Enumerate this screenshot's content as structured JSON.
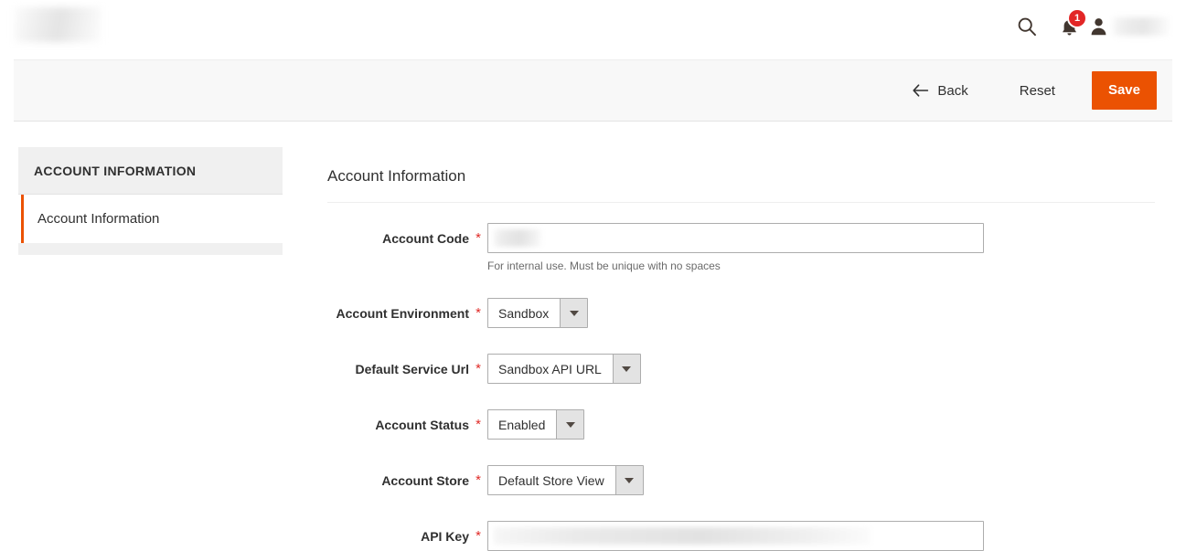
{
  "header": {
    "logo_redacted": true,
    "search_icon": "search-icon",
    "notifications_icon": "bell-icon",
    "notifications_count": "1",
    "user_icon": "user-icon",
    "user_name_redacted": true
  },
  "toolbar": {
    "back_label": "Back",
    "back_icon": "arrow-left-icon",
    "reset_label": "Reset",
    "save_label": "Save",
    "save_color": "#eb5202"
  },
  "sidebar": {
    "title": "ACCOUNT INFORMATION",
    "items": [
      {
        "label": "Account Information",
        "active": true
      }
    ]
  },
  "main": {
    "section_title": "Account Information",
    "fields": [
      {
        "label": "Account Code",
        "required": "*",
        "type": "text",
        "value": "",
        "redacted": true,
        "help": "For internal use. Must be unique with no spaces"
      },
      {
        "label": "Account Environment",
        "required": "*",
        "type": "select",
        "value": "Sandbox"
      },
      {
        "label": "Default Service Url",
        "required": "*",
        "type": "select",
        "value": "Sandbox API URL"
      },
      {
        "label": "Account Status",
        "required": "*",
        "type": "select",
        "value": "Enabled"
      },
      {
        "label": "Account Store",
        "required": "*",
        "type": "select",
        "value": "Default Store View"
      },
      {
        "label": "API Key",
        "required": "*",
        "type": "text",
        "value": "",
        "redacted": true
      }
    ]
  }
}
